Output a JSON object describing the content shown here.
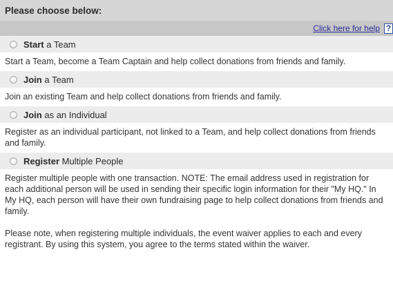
{
  "header": {
    "title": "Please choose below:"
  },
  "help": {
    "link_text": "Click here for help",
    "icon_glyph": "?",
    "icon": "help-question-icon"
  },
  "options": [
    {
      "bold": "Start",
      "rest": " a Team",
      "selected": false,
      "description": "Start a Team, become a Team Captain and help collect donations from friends and family."
    },
    {
      "bold": "Join",
      "rest": " a Team",
      "selected": false,
      "description": "Join an existing Team and help collect donations from friends and family."
    },
    {
      "bold": "Join",
      "rest": " as an Individual",
      "selected": false,
      "description": "Register as an individual participant, not linked to a Team, and help collect donations from friends and family."
    },
    {
      "bold": "Register",
      "rest": " Multiple People",
      "selected": false,
      "description": "Register multiple people with one transaction. NOTE: The email address used in registration for each additional person will be used in sending their specific login information for their \"My HQ.\" In My HQ, each person will have their own fundraising page to help collect donations from friends and family.",
      "note": "Please note, when registering multiple individuals, the event waiver applies to each and every registrant. By using this system, you agree to the terms stated within the waiver."
    }
  ],
  "colors": {
    "header_bg": "#d6d6d6",
    "help_bar_bg": "#c7c7c7",
    "option_bg": "#ececec",
    "link": "#2b2b9a",
    "help_icon_border": "#2b4fa0"
  }
}
